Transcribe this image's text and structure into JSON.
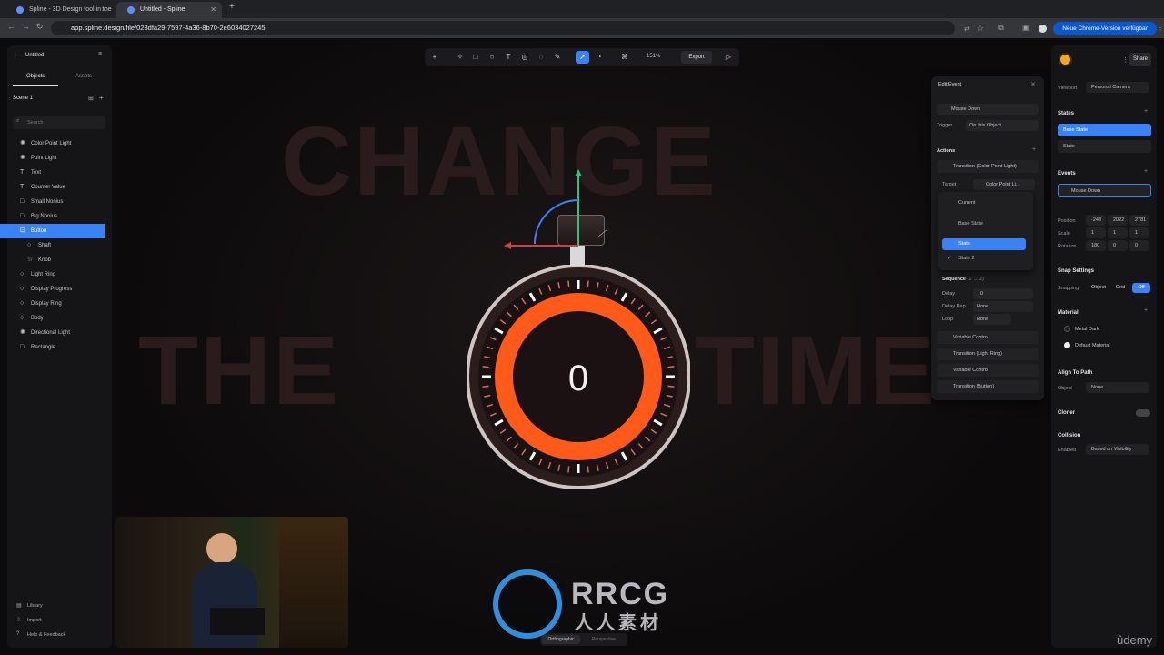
{
  "browser": {
    "tabs": [
      {
        "label": "Spline - 3D Design tool in the"
      },
      {
        "label": "Untitled - Spline"
      }
    ],
    "url": "app.spline.design/file/023dfa29-7597-4a36-8b70-2e6034027245",
    "update_label": "Neue Chrome-Version verfügbar"
  },
  "left_panel": {
    "file_name": "Untitled",
    "tabs": [
      "Objects",
      "Assets"
    ],
    "scene": "Scene 1",
    "search_placeholder": "Search",
    "items": [
      {
        "label": "Color Point Light",
        "icon": "light-icon"
      },
      {
        "label": "Point Light",
        "icon": "light-icon"
      },
      {
        "label": "Text",
        "icon": "text-icon"
      },
      {
        "label": "Counter Value",
        "icon": "text-icon"
      },
      {
        "label": "Small Nonius",
        "icon": "shape-icon"
      },
      {
        "label": "Big Nonius",
        "icon": "shape-icon"
      },
      {
        "label": "Button",
        "icon": "group-icon",
        "selected": true
      },
      {
        "label": "Shaft",
        "icon": "circle-icon",
        "child": true
      },
      {
        "label": "Knob",
        "icon": "star-icon",
        "child": true
      },
      {
        "label": "Light Ring",
        "icon": "circle-icon"
      },
      {
        "label": "Display Progress",
        "icon": "circle-icon"
      },
      {
        "label": "Display Ring",
        "icon": "circle-icon"
      },
      {
        "label": "Body",
        "icon": "circle-icon"
      },
      {
        "label": "Directional Light",
        "icon": "light-icon"
      },
      {
        "label": "Rectangle",
        "icon": "shape-icon"
      }
    ],
    "footer": [
      "Library",
      "Import",
      "Help & Feedback"
    ]
  },
  "toolbar": {
    "zoom": "151%",
    "export_label": "Export"
  },
  "canvas": {
    "headline_top": "CHANGE",
    "headline_bottom_left": "THE",
    "headline_bottom_right": "TIME",
    "counter": "0",
    "view_modes": [
      "Orthographic",
      "Perspective"
    ],
    "watermark_main": "RRCG",
    "watermark_sub": "人人素材",
    "brand": "ûdemy"
  },
  "edit_event": {
    "title": "Edit Event",
    "event": "Mouse Down",
    "trigger_label": "Trigger",
    "trigger_value": "On this Object",
    "actions_label": "Actions",
    "action_main": "Transition (Color Point Light)",
    "target_label": "Target",
    "target_value": "Color Point Li...",
    "dropdown": [
      "Current",
      "Base State",
      "State",
      "State 2"
    ],
    "sequence_label": "Sequence",
    "sequence_range": "(1 → 2)",
    "delay_label": "Delay",
    "delay_value": "0",
    "delay_repeat_label": "Delay Rep...",
    "delay_repeat_value": "None",
    "loop_label": "Loop",
    "loop_value": "None",
    "other_actions": [
      "Variable Control",
      "Transition (Light Ring)",
      "Variable Control",
      "Transition (Button)"
    ]
  },
  "right_panel": {
    "share_label": "Share",
    "viewport_label": "Viewport",
    "viewport_value": "Personal Camera",
    "states_label": "States",
    "states": [
      "Base State",
      "State"
    ],
    "events_label": "Events",
    "event_item": "Mouse Down",
    "position_label": "Position",
    "position": [
      "-243",
      "2022",
      "2781"
    ],
    "scale_label": "Scale",
    "scale": [
      "1",
      "1",
      "1"
    ],
    "rotation_label": "Rotation",
    "rotation": [
      "180",
      "0",
      "0"
    ],
    "snap_label": "Snap Settings",
    "snapping_label": "Snapping",
    "snap_options": [
      "Object",
      "Grid",
      "Off"
    ],
    "material_label": "Material",
    "materials": [
      "Metal Dark",
      "Default Material"
    ],
    "align_label": "Align To Path",
    "object_label": "Object",
    "object_value": "None",
    "cloner_label": "Cloner",
    "collision_label": "Collision",
    "enabled_label": "Enabled",
    "enabled_value": "Based on Visibility"
  },
  "colors": {
    "accent": "#3b82f6",
    "orange": "#ff5a1a"
  }
}
